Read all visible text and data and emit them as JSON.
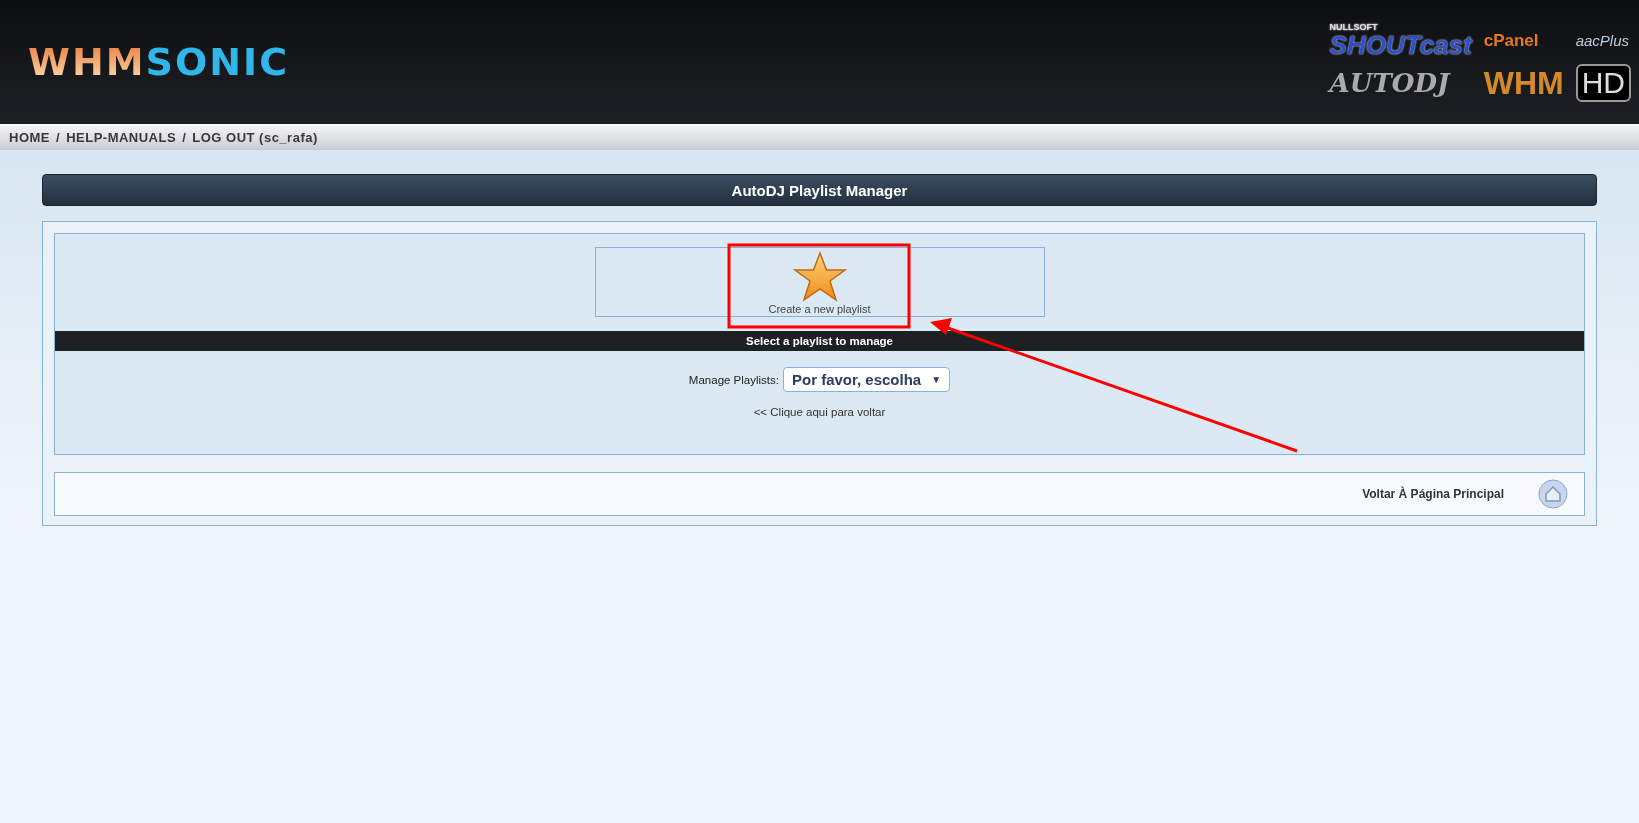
{
  "header": {
    "logo": {
      "part_1": "WHM",
      "part_2": "SONIC"
    },
    "partner_logos": [
      {
        "kind": "shoutcast",
        "top": "NULLSOFT",
        "main": "SHOUTcast"
      },
      {
        "kind": "cpanel",
        "main": "cPanel"
      },
      {
        "kind": "aacplus",
        "main": "aacPlus"
      },
      {
        "kind": "autodj",
        "main": "AUTODJ"
      },
      {
        "kind": "whm",
        "main": "WHM"
      },
      {
        "kind": "hd",
        "main": "HD"
      }
    ]
  },
  "nav": {
    "items": [
      "HOME",
      "HELP-MANUALS",
      "LOG OUT (sc_rafa)"
    ],
    "separator": "/"
  },
  "title": "AutoDJ Playlist Manager",
  "create": {
    "label": "Create a new playlist"
  },
  "section_title": "Select a playlist to manage",
  "manage": {
    "label": "Manage Playlists:",
    "value": "Por favor, escolha",
    "caret": "▼"
  },
  "back_link": "<< Clique aqui para voltar",
  "footer": {
    "label": "Voltar À Página Principal"
  }
}
